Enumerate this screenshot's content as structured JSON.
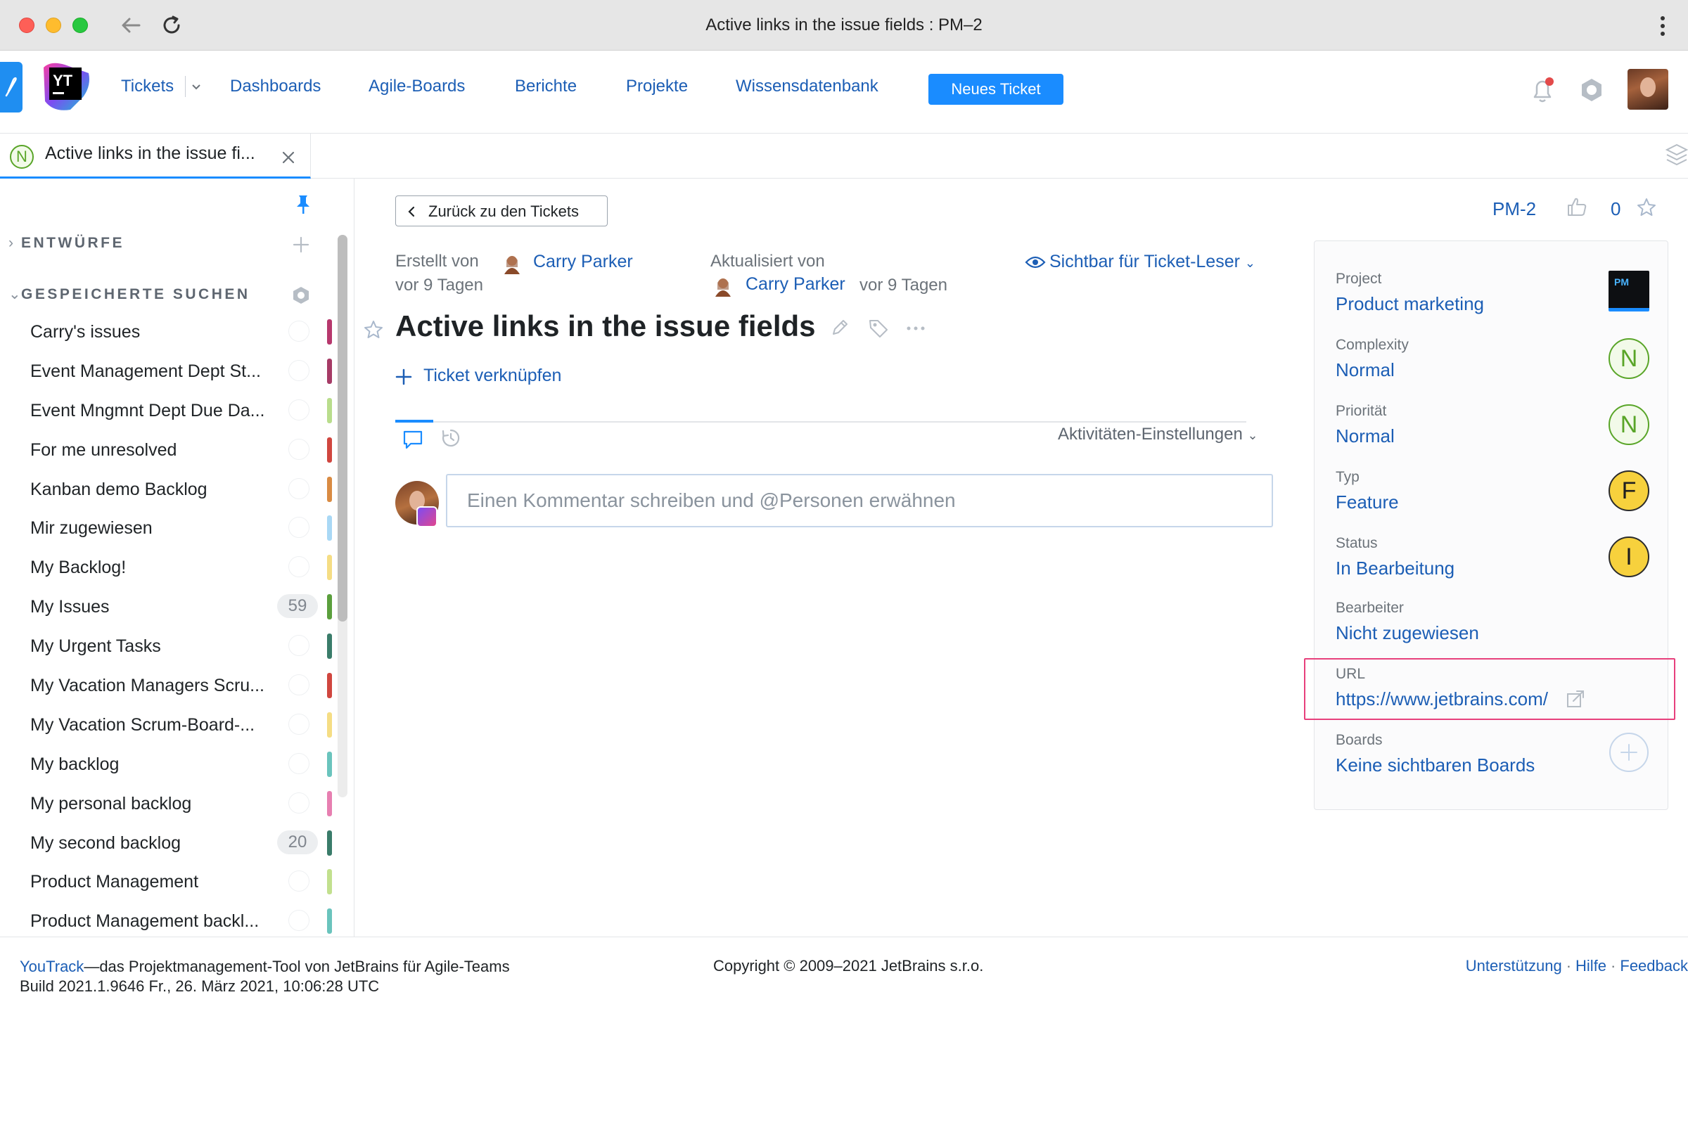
{
  "window": {
    "title": "Active links in the issue fields : PM–2"
  },
  "header": {
    "nav": [
      {
        "label": "Tickets"
      },
      {
        "label": "Dashboards"
      },
      {
        "label": "Agile-Boards"
      },
      {
        "label": "Berichte"
      },
      {
        "label": "Projekte"
      },
      {
        "label": "Wissensdatenbank"
      }
    ],
    "new_ticket_label": "Neues Ticket",
    "logo_text": "YT",
    "accent_color": "#1a8cff",
    "link_color": "#1c5eb5"
  },
  "tab": {
    "badge": "N",
    "title": "Active links in the issue fi..."
  },
  "sidebar": {
    "drafts_heading": "ENTWÜRFE",
    "saved_heading": "GESPEICHERTE SUCHEN",
    "saved_searches": [
      {
        "label": "Carry's issues",
        "count": "",
        "color": "#b7386d"
      },
      {
        "label": "Event Management Dept St...",
        "count": "",
        "color": "#a63b66"
      },
      {
        "label": "Event Mngmnt Dept Due Da...",
        "count": "",
        "color": "#b9dd8c"
      },
      {
        "label": "For me unresolved",
        "count": "",
        "color": "#d0463f"
      },
      {
        "label": "Kanban demo Backlog",
        "count": "",
        "color": "#d98b43"
      },
      {
        "label": "Mir zugewiesen",
        "count": "",
        "color": "#a9d8f5"
      },
      {
        "label": "My Backlog!",
        "count": "",
        "color": "#f5dd84"
      },
      {
        "label": "My Issues",
        "count": "59",
        "color": "#5b9f3d"
      },
      {
        "label": "My Urgent Tasks",
        "count": "",
        "color": "#3a7c6a"
      },
      {
        "label": "My Vacation Managers Scru...",
        "count": "",
        "color": "#d0463f"
      },
      {
        "label": "My Vacation Scrum-Board-...",
        "count": "",
        "color": "#f5dd84"
      },
      {
        "label": "My backlog",
        "count": "",
        "color": "#6ac4bd"
      },
      {
        "label": "My personal backlog",
        "count": "",
        "color": "#e77fb1"
      },
      {
        "label": "My second backlog",
        "count": "20",
        "color": "#3a7c6a"
      },
      {
        "label": "Product Management",
        "count": "",
        "color": "#c2e08e"
      },
      {
        "label": "Product Management backl...",
        "count": "",
        "color": "#6ac4bd"
      }
    ]
  },
  "issue": {
    "back_label": "Zurück zu den Tickets",
    "created_label": "Erstellt von",
    "created_by": "Carry Parker",
    "created_ago": "vor 9 Tagen",
    "updated_label": "Aktualisiert von",
    "updated_by": "Carry Parker",
    "updated_ago": "vor 9 Tagen",
    "visibility": "Sichtbar für Ticket-Leser",
    "title": "Active links in the issue fields",
    "link_ticket": "Ticket verknüpfen",
    "activity_settings": "Aktivitäten-Einstellungen",
    "comment_placeholder": "Einen Kommentar schreiben und @Personen erwähnen",
    "id": "PM-2",
    "votes": "0"
  },
  "fields": [
    {
      "label": "Project",
      "value": "Product marketing",
      "badge": "PM"
    },
    {
      "label": "Complexity",
      "value": "Normal",
      "badge": "N"
    },
    {
      "label": "Priorität",
      "value": "Normal",
      "badge": "N"
    },
    {
      "label": "Typ",
      "value": "Feature",
      "badge": "F"
    },
    {
      "label": "Status",
      "value": "In Bearbeitung",
      "badge": "I"
    },
    {
      "label": "Bearbeiter",
      "value": "Nicht zugewiesen",
      "badge": ""
    },
    {
      "label": "URL",
      "value": "https://www.jetbrains.com/",
      "badge": ""
    },
    {
      "label": "Boards",
      "value": "Keine sichtbaren Boards",
      "badge": ""
    }
  ],
  "footer": {
    "product_link": "YouTrack",
    "tagline": "—das Projektmanagement-Tool von JetBrains für Agile-Teams",
    "build": "Build 2021.1.9646 Fr., 26. März 2021, 10:06:28 UTC",
    "copyright": "Copyright © 2009–2021 JetBrains s.r.o.",
    "links": [
      "Unterstützung",
      "Hilfe",
      "Feedback"
    ]
  }
}
